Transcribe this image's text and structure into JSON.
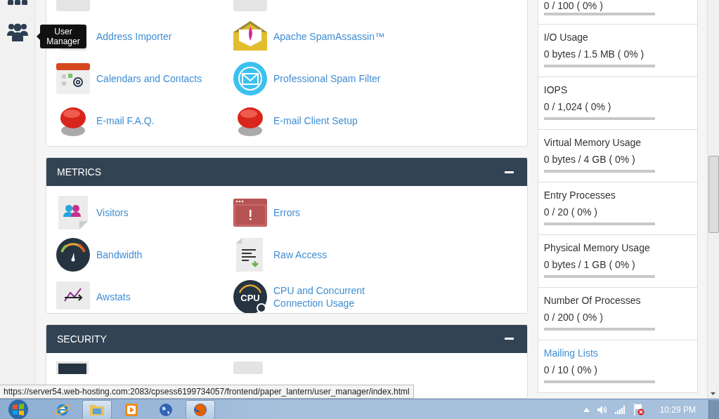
{
  "sidebar": {
    "tooltip": "User Manager"
  },
  "email_section": {
    "items": [
      {
        "kind": "importer",
        "label": "Address Importer"
      },
      {
        "kind": "spamassassin",
        "label": "Apache SpamAssassin™"
      },
      {
        "kind": "calendar",
        "label": "Calendars and Contacts"
      },
      {
        "kind": "spamfilter",
        "label": "Professional Spam Filter"
      },
      {
        "kind": "help",
        "label": "E-mail F.A.Q."
      },
      {
        "kind": "help",
        "label": "E-mail Client Setup"
      }
    ]
  },
  "metrics_section": {
    "title": "METRICS",
    "items": [
      {
        "kind": "visitors",
        "label": "Visitors"
      },
      {
        "kind": "errors",
        "label": "Errors"
      },
      {
        "kind": "bandwidth",
        "label": "Bandwidth"
      },
      {
        "kind": "rawaccess",
        "label": "Raw Access"
      },
      {
        "kind": "awstats",
        "label": "Awstats"
      },
      {
        "kind": "cpu",
        "label": "CPU and Concurrent Connection Usage",
        "icon_text": "CPU"
      }
    ]
  },
  "security_section": {
    "title": "SECURITY"
  },
  "stats": [
    {
      "value": "0 / 100 ( 0% )",
      "level": 0
    },
    {
      "label": "I/O Usage",
      "value": "0 bytes / 1.5 MB ( 0% )",
      "level": 0,
      "link": false
    },
    {
      "label": "IOPS",
      "value": "0 / 1,024 ( 0% )",
      "level": 0,
      "link": false
    },
    {
      "label": "Virtual Memory Usage",
      "value": "0 bytes / 4 GB ( 0% )",
      "level": 0,
      "link": false
    },
    {
      "label": "Entry Processes",
      "value": "0 / 20 ( 0% )",
      "level": 0,
      "link": false
    },
    {
      "label": "Physical Memory Usage",
      "value": "0 bytes / 1 GB ( 0% )",
      "level": 0,
      "link": false
    },
    {
      "label": "Number Of Processes",
      "value": "0 / 200 ( 0% )",
      "level": 0,
      "link": false
    },
    {
      "label": "Mailing Lists",
      "value": "0 / 10 ( 0% )",
      "level": 0,
      "link": true
    }
  ],
  "status_url": "https://server54.web-hosting.com:2083/cpsess6199734057/frontend/paper_lantern/user_manager/index.html",
  "taskbar": {
    "apps": [
      {
        "kind": "ie",
        "selected": false
      },
      {
        "kind": "folder",
        "selected": true
      },
      {
        "kind": "media",
        "selected": false
      },
      {
        "kind": "globe",
        "selected": false
      },
      {
        "kind": "firefox",
        "selected": true
      }
    ],
    "clock": "10:29 PM"
  }
}
